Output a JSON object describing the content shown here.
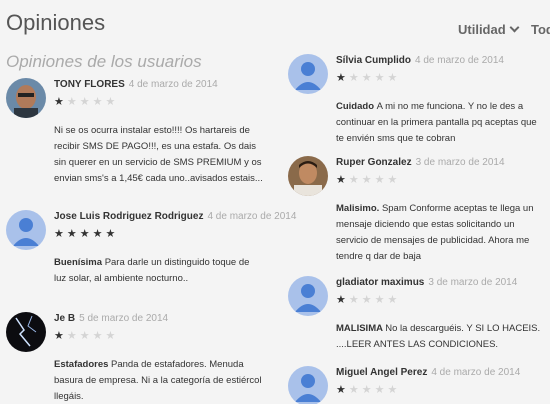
{
  "header": {
    "title": "Opiniones",
    "sort_label": "Utilidad",
    "sort_other": "Tod"
  },
  "section_title": "Opiniones de los usuarios",
  "reviews_left": [
    {
      "author": "TONY FLORES",
      "date": "4 de marzo de 2014",
      "rating": 1,
      "title": "",
      "text": "Ni se os ocurra instalar esto!!!! Os hartareis de recibir SMS DE PAGO!!!, es una estafa. Os dais sin querer en un servicio de SMS PREMIUM y os envian sms's a 1,45€ cada uno..avisados estais...",
      "avatar": "photo-man"
    },
    {
      "author": "Jose Luis Rodriguez Rodriguez",
      "date": "4 de marzo de 2014",
      "rating": 5,
      "title": "Buenísima",
      "text": "Para darle un distinguido toque de luz solar, al ambiente nocturno..",
      "avatar": "default"
    },
    {
      "author": "Je B",
      "date": "5 de marzo de 2014",
      "rating": 1,
      "title": "Estafadores",
      "text": "Panda de estafadores. Menuda basura de empresa. Ni a la categoría de estiércol llegáis.",
      "avatar": "photo-dark"
    }
  ],
  "reviews_right": [
    {
      "author": "Sílvia Cumplido",
      "date": "4 de marzo de 2014",
      "rating": 1,
      "title": "Cuidado",
      "text": "A mi no me funciona. Y no le des a continuar en la primera pantalla pq aceptas que te envién sms que te cobran",
      "avatar": "default"
    },
    {
      "author": "Ruper Gonzalez",
      "date": "3 de marzo de 2014",
      "rating": 1,
      "title": "Malisimo.",
      "text": "Spam Conforme aceptas te llega un mensaje diciendo que estas solicitando un servicio de mensajes de publicidad. Ahora me tendre q dar de baja",
      "avatar": "photo-man2"
    },
    {
      "author": "gladiator maximus",
      "date": "3 de marzo de 2014",
      "rating": 1,
      "title": "MALISIMA",
      "text": "No la descarguéis. Y SI LO HACEIS. ....LEER ANTES LAS CONDICIONES.",
      "avatar": "default"
    },
    {
      "author": "Miguel Angel Perez",
      "date": "4 de marzo de 2014",
      "rating": 1,
      "title": "",
      "text": "",
      "avatar": "default"
    }
  ]
}
